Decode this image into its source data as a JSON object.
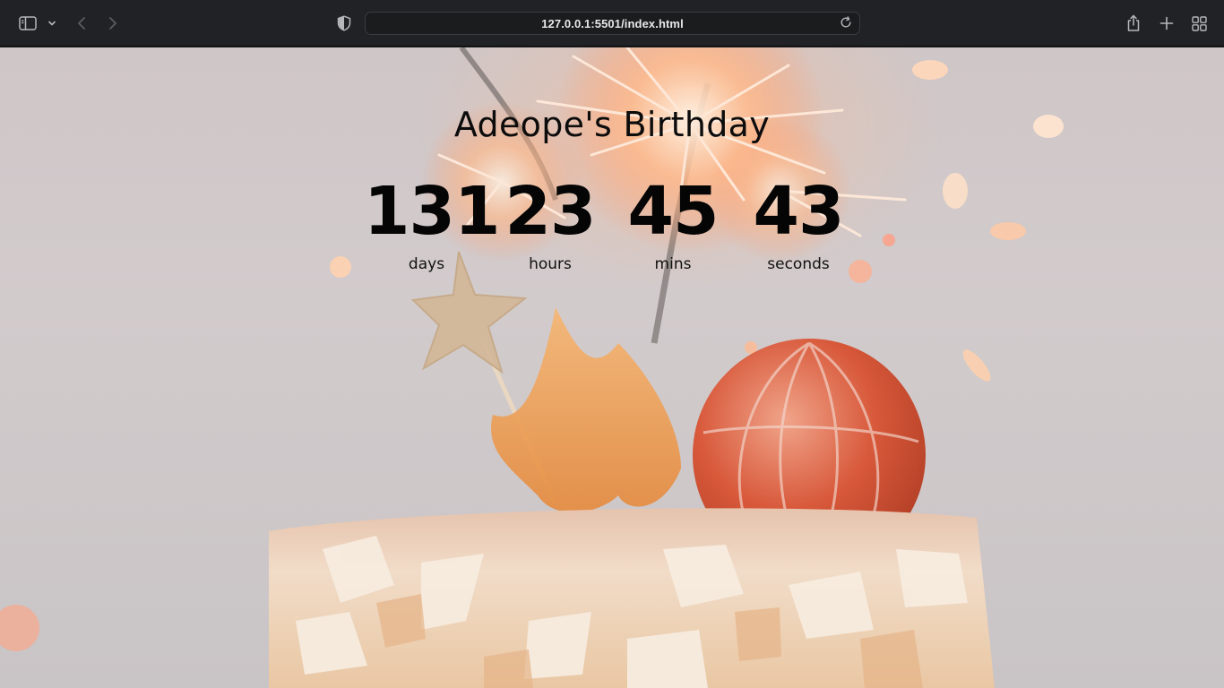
{
  "browser": {
    "url": "127.0.0.1:5501/index.html",
    "icons": {
      "sidebar": "sidebar-icon",
      "chevron": "chevron-down-icon",
      "back": "back-arrow-icon",
      "forward": "forward-arrow-icon",
      "shield": "privacy-shield-icon",
      "reload": "reload-icon",
      "share": "share-icon",
      "new_tab": "plus-icon",
      "tab_overview": "tab-grid-icon"
    }
  },
  "page": {
    "title": "Adeope's Birthday",
    "countdown": [
      {
        "value": "131",
        "label": "days"
      },
      {
        "value": "23",
        "label": "hours"
      },
      {
        "value": "45",
        "label": "mins"
      },
      {
        "value": "43",
        "label": "seconds"
      }
    ],
    "text_color": "#050505"
  }
}
